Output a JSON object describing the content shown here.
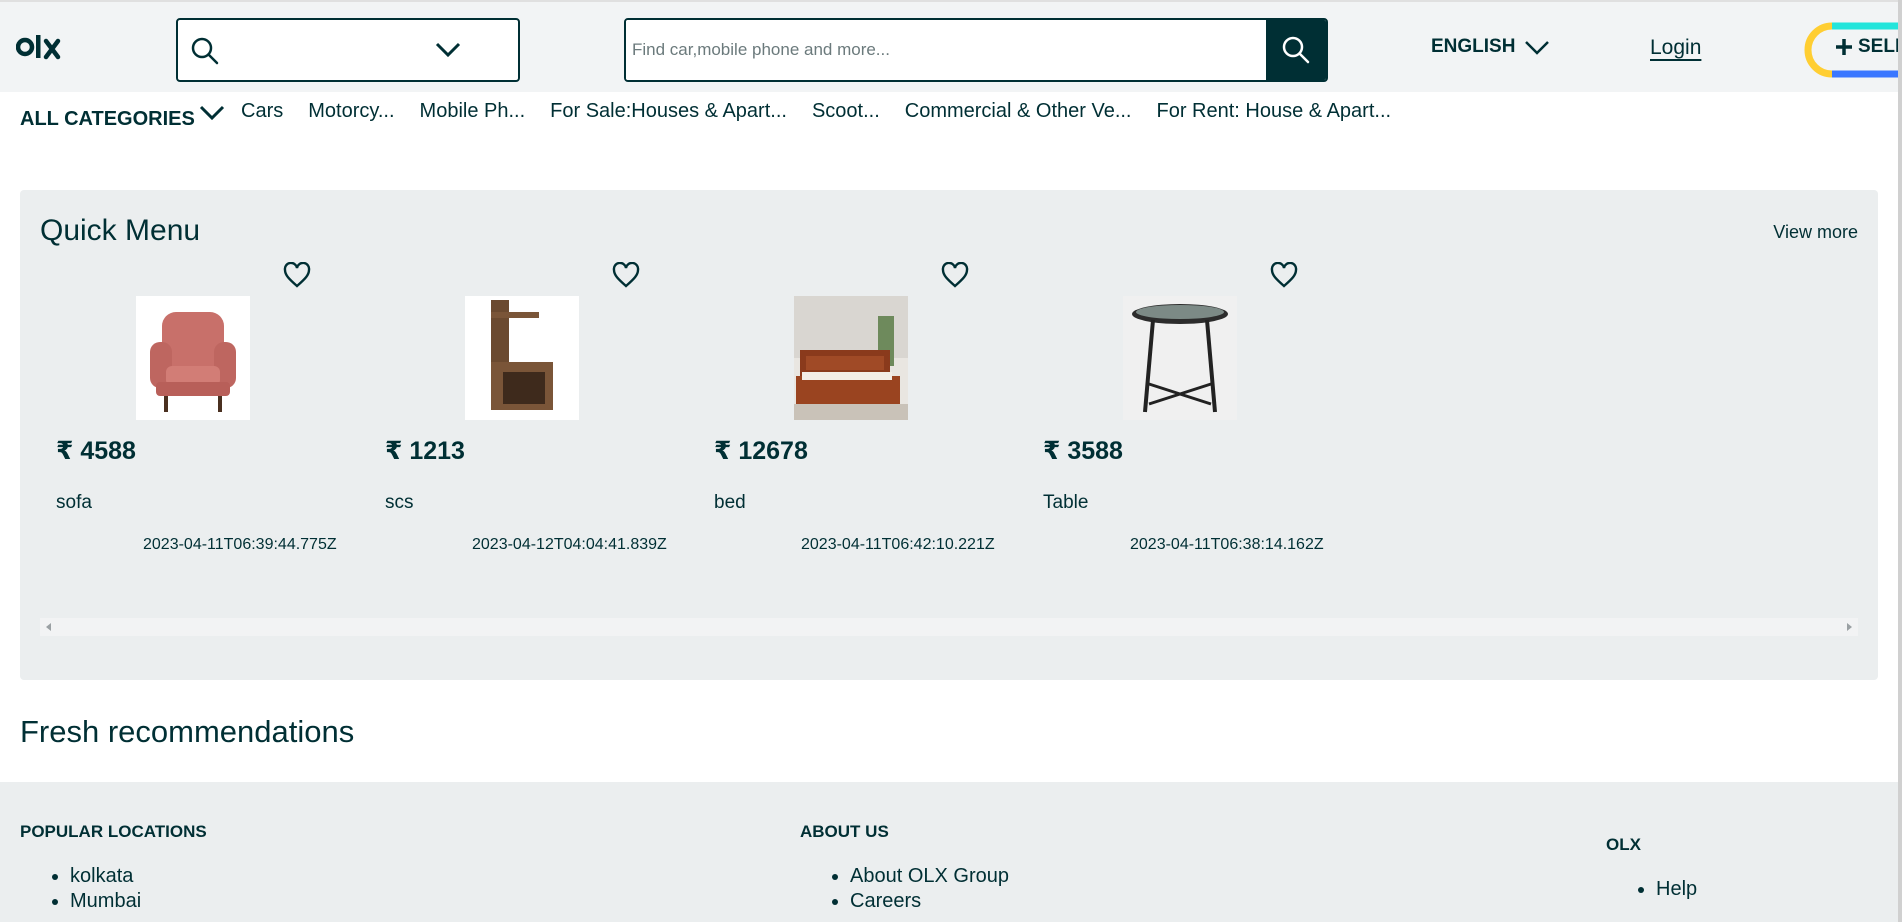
{
  "header": {
    "search_placeholder": "Find car,mobile phone and more...",
    "language": "ENGLISH",
    "login": "Login",
    "sell": "SELL"
  },
  "categories": {
    "all_label": "ALL CATEGORIES",
    "items": [
      "Cars",
      "Motorcy...",
      "Mobile Ph...",
      "For Sale:Houses & Apart...",
      "Scoot...",
      "Commercial & Other Ve...",
      "For Rent: House & Apart..."
    ]
  },
  "quick_menu": {
    "title": "Quick Menu",
    "view_more": "View more",
    "items": [
      {
        "price": "₹ 4588",
        "name": "sofa",
        "date": "2023-04-11T06:39:44.775Z"
      },
      {
        "price": "₹ 1213",
        "name": "scs",
        "date": "2023-04-12T04:04:41.839Z"
      },
      {
        "price": "₹ 12678",
        "name": "bed",
        "date": "2023-04-11T06:42:10.221Z"
      },
      {
        "price": "₹ 3588",
        "name": "Table",
        "date": "2023-04-11T06:38:14.162Z"
      }
    ]
  },
  "fresh": {
    "title": "Fresh recommendations"
  },
  "footer": {
    "popular": {
      "title": "POPULAR LOCATIONS",
      "items": [
        "kolkata",
        "Mumbai"
      ]
    },
    "about": {
      "title": "ABOUT US",
      "items": [
        "About OLX Group",
        "Careers"
      ]
    },
    "olx": {
      "title": "OLX",
      "items": [
        "Help"
      ]
    }
  },
  "colors": {
    "brand": "#002f34",
    "background": "#f2f4f5",
    "card_bg": "#ebeeef"
  }
}
